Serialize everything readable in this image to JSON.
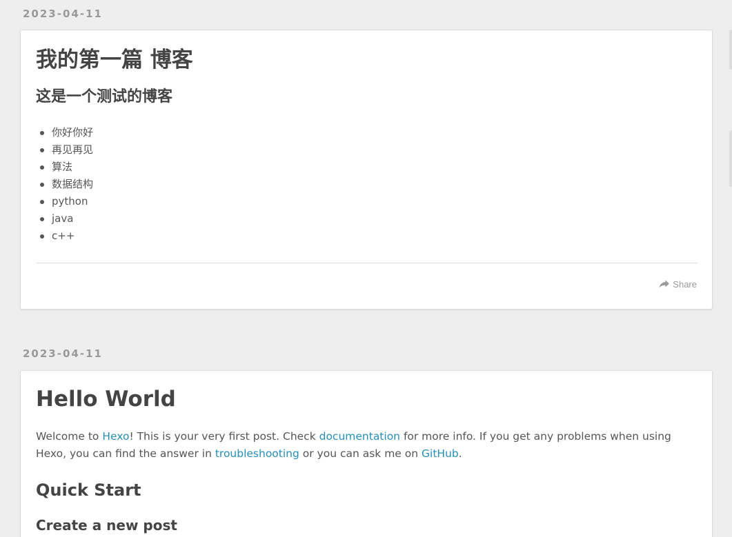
{
  "posts": [
    {
      "date": "2023-04-11",
      "title": "我的第一篇 博客",
      "subtitle": "这是一个测试的博客",
      "items": [
        "你好你好",
        "再见再见",
        "算法",
        "数据结构",
        "python",
        "java",
        "c++"
      ],
      "share_label": "Share"
    },
    {
      "date": "2023-04-11",
      "title": "Hello World",
      "intro": {
        "t1": "Welcome to ",
        "link_hexo": "Hexo",
        "t2": "! This is your very first post. Check ",
        "link_docs": "documentation",
        "t3": " for more info. If you get any problems when using Hexo, you can find the answer in ",
        "link_troubleshooting": "troubleshooting",
        "t4": " or you can ask me on ",
        "link_github": "GitHub",
        "t5": "."
      },
      "h2": "Quick Start",
      "h3": "Create a new post"
    }
  ],
  "colors": {
    "background": "#eeeeee",
    "card": "#ffffff",
    "link": "#258fb8",
    "heading": "#444444",
    "muted": "#999999"
  },
  "icons": {
    "share": "share-icon"
  }
}
